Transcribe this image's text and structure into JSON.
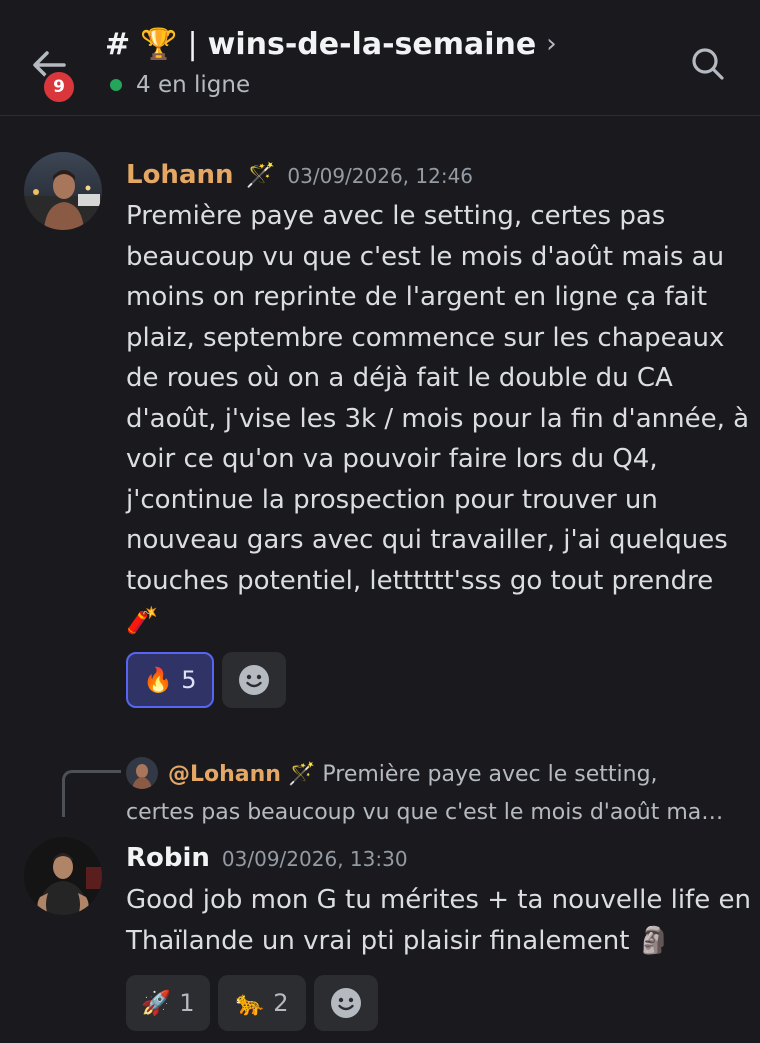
{
  "header": {
    "back_badge": "9",
    "hash": "#",
    "channel_emoji": "🏆",
    "separator": "|",
    "channel_name": "wins-de-la-semaine",
    "chevron": "›",
    "online": "4 en ligne"
  },
  "messages": [
    {
      "author": "Lohann",
      "author_badge": "🪄",
      "author_color": "#e5a764",
      "timestamp": "03/09/2026, 12:46",
      "lines": [
        "Première paye avec le setting, certes pas",
        "beaucoup vu que c'est le mois d'août mais au",
        "moins on reprinte de l'argent en ligne ça fait",
        "plaiz, septembre commence sur les chapeaux",
        "de roues où on a déjà fait le double du CA",
        "d'août, j'vise les 3k / mois pour la fin d'année, à",
        "voir ce qu'on va pouvoir faire lors du Q4,",
        "j'continue la prospection pour trouver un",
        "nouveau gars avec qui travailler, j'ai quelques",
        "touches potentiel, letttttt'sss go tout prendre"
      ],
      "trailing_emoji": "🧨",
      "reactions": [
        {
          "emoji": "🔥",
          "count": "5",
          "active": true
        }
      ]
    },
    {
      "reply": {
        "mention": "@Lohann",
        "badge": "🪄",
        "mention_color": "#e5a764",
        "preview_line1": "Première paye avec le setting,",
        "preview_line2": "certes pas beaucoup vu que c'est le mois d'août ma…"
      },
      "author": "Robin",
      "author_color": "#f2f3f5",
      "timestamp": "03/09/2026, 13:30",
      "lines": [
        "Good job mon G tu mérites + ta nouvelle life en",
        "Thaïlande un vrai pti plaisir finalement"
      ],
      "trailing_emoji": "🗿",
      "reactions": [
        {
          "emoji": "🚀",
          "count": "1",
          "active": false
        },
        {
          "emoji": "🐆",
          "count": "2",
          "active": false
        }
      ]
    }
  ],
  "colors": {
    "background": "#1a1a1e",
    "accent": "#5865f2",
    "online": "#23a55a",
    "badge": "#da373c"
  }
}
